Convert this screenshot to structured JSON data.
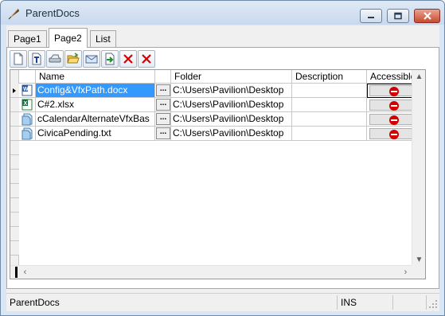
{
  "window": {
    "title": "ParentDocs",
    "icons": {
      "app": "feather-quill-icon",
      "minimize": "minimize-icon",
      "maximize": "maximize-icon",
      "close": "close-icon"
    }
  },
  "tabs": [
    {
      "label": "Page1"
    },
    {
      "label": "Page2"
    },
    {
      "label": "List"
    }
  ],
  "active_tab": "Page2",
  "toolbar": [
    {
      "icon": "new-document-icon"
    },
    {
      "icon": "text-document-icon"
    },
    {
      "icon": "scanner-icon"
    },
    {
      "icon": "open-folder-icon"
    },
    {
      "icon": "email-icon"
    },
    {
      "icon": "import-icon"
    },
    {
      "icon": "delete-icon"
    },
    {
      "icon": "delete-all-icon"
    }
  ],
  "grid": {
    "columns": {
      "name": "Name",
      "folder": "Folder",
      "description": "Description",
      "accessible": "Accessible"
    },
    "ellipsis": "...",
    "rows": [
      {
        "file_type_icon": "word-doc-icon",
        "name": "Config&VfxPath.docx",
        "folder": "C:\\Users\\Pavilion\\Desktop",
        "description": "",
        "accessible_icon": "no-entry-icon",
        "selected": true
      },
      {
        "file_type_icon": "excel-xlsx-icon",
        "name": "C#2.xlsx",
        "folder": "C:\\Users\\Pavilion\\Desktop",
        "description": "",
        "accessible_icon": "no-entry-icon",
        "selected": false
      },
      {
        "file_type_icon": "generic-file-icon",
        "name": "cCalendarAlternateVfxBas",
        "folder": "C:\\Users\\Pavilion\\Desktop",
        "description": "",
        "accessible_icon": "no-entry-icon",
        "selected": false
      },
      {
        "file_type_icon": "generic-file-icon",
        "name": "CivicaPending.txt",
        "folder": "C:\\Users\\Pavilion\\Desktop",
        "description": "",
        "accessible_icon": "no-entry-icon",
        "selected": false
      }
    ]
  },
  "status_bar": {
    "text": "ParentDocs",
    "mode": "INS"
  },
  "colors": {
    "selection": "#3399ff",
    "stop_red": "#d40000"
  }
}
